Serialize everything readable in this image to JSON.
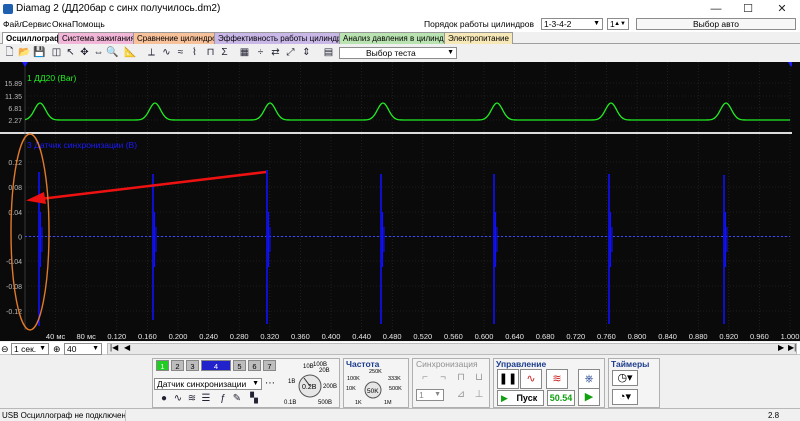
{
  "window": {
    "title": "Diamag 2 (ДД20бар с синх получилось.dm2)"
  },
  "menu": {
    "items": [
      "Файл",
      "Сервис",
      "Окна",
      "Помощь"
    ]
  },
  "cylinder_order": {
    "label": "Порядок работы цилиндров",
    "value": "1-3-4-2",
    "cyl_value": "1",
    "auto_select": "Выбор авто"
  },
  "tabs": [
    "Осциллограф",
    "Система зажигания",
    "Сравнение цилиндров",
    "Эффективность работы цилиндров",
    "Анализ давления в цилиндре",
    "Электропитание"
  ],
  "tab_colors": [
    "#ffffff",
    "#f2b6d8",
    "#f7c19a",
    "#c9b7e8",
    "#b9e3b0",
    "#f7e9b7"
  ],
  "toolbar": {
    "test_select": "Выбор теста"
  },
  "channel1": {
    "label": "1 ДД20 (Bar)",
    "ticks": [
      "15.89",
      "11.35",
      "6.81",
      "2.27"
    ],
    "color": "#22ee22"
  },
  "channel2": {
    "label": "3 Датчик синхронизации (B)",
    "ticks": [
      "0.12",
      "0.08",
      "0.04",
      "0",
      "-0.04",
      "-0.08",
      "-0.12"
    ],
    "color": "#1010ff"
  },
  "time_axis": {
    "labels": [
      "40 мс",
      "80 мс",
      "0.120",
      "0.160",
      "0.200",
      "0.240",
      "0.280",
      "0.320",
      "0.360",
      "0.400",
      "0.440",
      "0.480",
      "0.520",
      "0.560",
      "0.600",
      "0.640",
      "0.680",
      "0.720",
      "0.760",
      "0.800",
      "0.840",
      "0.880",
      "0.920",
      "0.960",
      "1.000"
    ]
  },
  "bottom": {
    "timebase": "1 сек.",
    "zoom": "40",
    "channel_buttons": [
      "1",
      "2",
      "3",
      "4",
      "5",
      "6",
      "7"
    ],
    "sensor": "Датчик синхронизации",
    "range_labels": [
      "10B",
      "20B",
      "100B",
      "1B",
      "0.2B",
      "200B",
      "0.1B",
      "500B"
    ],
    "freq_title": "Частота",
    "freq_labels": [
      "250K",
      "100K",
      "333K",
      "10K",
      "50K",
      "500K",
      "1K",
      "1M"
    ],
    "sync_title": "Синхронизация",
    "sync_value": "1",
    "control_title": "Управление",
    "start_label": "Пуск",
    "rate_value": "50.54",
    "timers_title": "Таймеры"
  },
  "status": {
    "left": "USB Осциллограф не подключен",
    "right": "2.8"
  }
}
